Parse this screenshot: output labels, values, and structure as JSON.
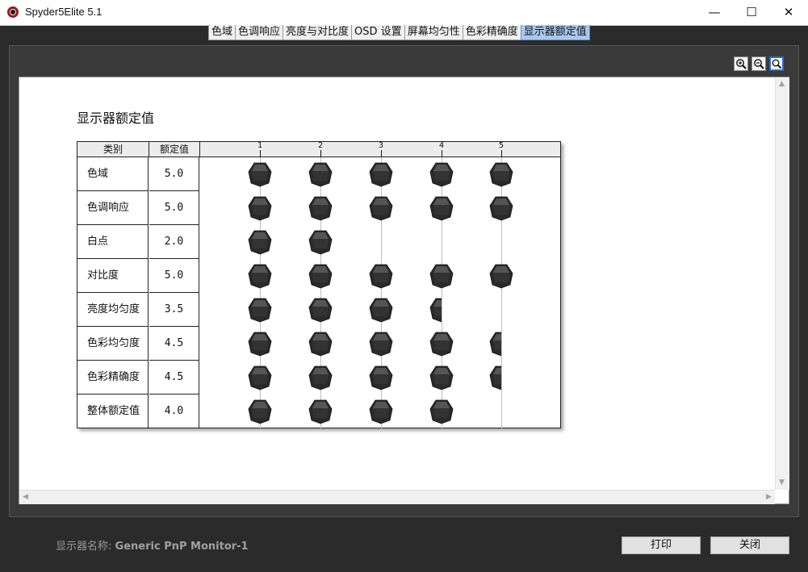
{
  "window": {
    "title": "Spyder5Elite 5.1",
    "minimize_glyph": "—",
    "maximize_glyph": "☐",
    "close_glyph": "✕"
  },
  "tabs": [
    {
      "label": "色域",
      "active": false
    },
    {
      "label": "色调响应",
      "active": false
    },
    {
      "label": "亮度与对比度",
      "active": false
    },
    {
      "label": "OSD 设置",
      "active": false
    },
    {
      "label": "屏幕均匀性",
      "active": false
    },
    {
      "label": "色彩精确度",
      "active": false
    },
    {
      "label": "显示器额定值",
      "active": true
    }
  ],
  "zoom": {
    "icons": [
      "zoom-in-icon",
      "zoom-out-icon",
      "zoom-fit-icon"
    ],
    "active_index": 2
  },
  "report": {
    "title": "显示器额定值",
    "headers": {
      "category": "类别",
      "rating": "额定值"
    },
    "scale_ticks": [
      "1",
      "2",
      "3",
      "4",
      "5"
    ],
    "rows": [
      {
        "category": "色域",
        "rating_text": "5.0",
        "rating": 5.0
      },
      {
        "category": "色调响应",
        "rating_text": "5.0",
        "rating": 5.0
      },
      {
        "category": "白点",
        "rating_text": "2.0",
        "rating": 2.0
      },
      {
        "category": "对比度",
        "rating_text": "5.0",
        "rating": 5.0
      },
      {
        "category": "亮度均匀度",
        "rating_text": "3.5",
        "rating": 3.5
      },
      {
        "category": "色彩均匀度",
        "rating_text": "4.5",
        "rating": 4.5
      },
      {
        "category": "色彩精确度",
        "rating_text": "4.5",
        "rating": 4.5
      },
      {
        "category": "整体额定值",
        "rating_text": "4.0",
        "rating": 4.0
      }
    ]
  },
  "footer": {
    "monitor_label": "显示器名称:",
    "monitor_name": "Generic PnP Monitor-1",
    "print_button": "打印",
    "close_button": "关闭"
  },
  "colors": {
    "active_tab": "#aac8ef",
    "gem": "#2a2a2a",
    "frame": "#2b2b2b"
  }
}
